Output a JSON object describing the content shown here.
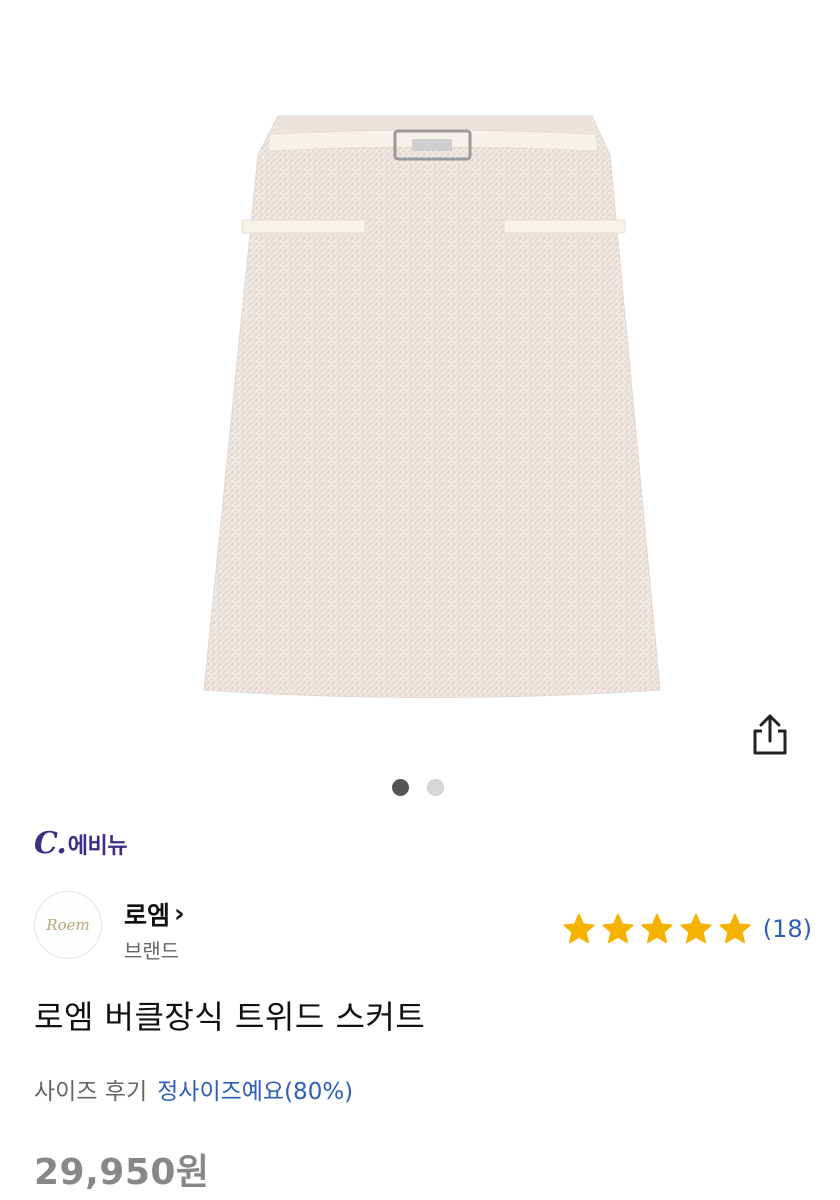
{
  "store": {
    "logo_c": "C.",
    "logo_name": "에비뉴"
  },
  "gallery": {
    "image_icon": "tweed-skirt-image",
    "total_images": 2,
    "active_index": 1
  },
  "share": {
    "icon": "share-icon"
  },
  "brand": {
    "avatar_text": "Roem",
    "name": "로엠",
    "chevron": "›",
    "type_label": "브랜드"
  },
  "rating": {
    "stars": 5,
    "count_text": "(18)",
    "star_color": "#F5B301"
  },
  "product": {
    "title": "로엠 버클장식 트위드 스커트"
  },
  "size_review": {
    "label": "사이즈 후기",
    "value": "정사이즈예요(80%)"
  },
  "price": {
    "text": "29,950원"
  },
  "colors": {
    "accent": "#2B5FB8",
    "logo": "#3A2E86",
    "price": "#888888"
  }
}
